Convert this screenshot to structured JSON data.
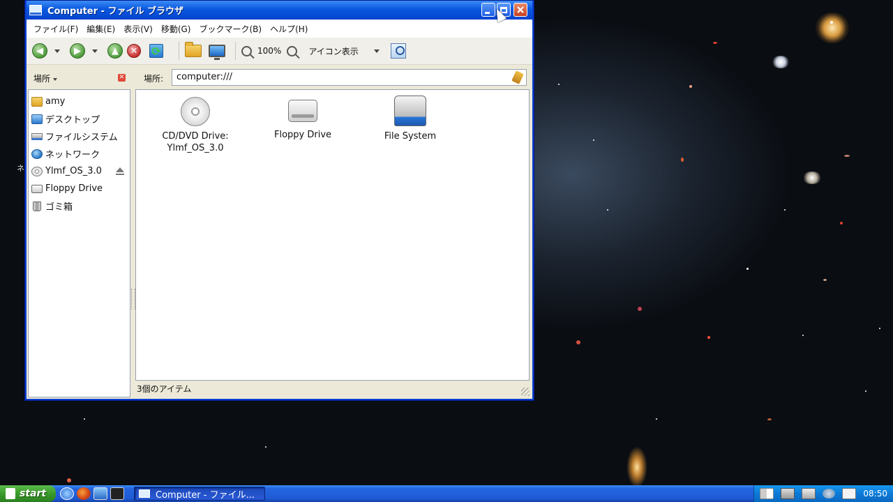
{
  "window": {
    "title": "Computer - ファイル ブラウザ"
  },
  "menubar": {
    "items": [
      "ファイル(F)",
      "編集(E)",
      "表示(V)",
      "移動(G)",
      "ブックマーク(B)",
      "ヘルプ(H)"
    ]
  },
  "toolbar": {
    "zoom": "100%",
    "view_mode": "アイコン表示"
  },
  "sidebar": {
    "header": "場所",
    "items": [
      {
        "label": "amy",
        "icon": "home-folder-icon"
      },
      {
        "label": "デスクトップ",
        "icon": "desktop-icon"
      },
      {
        "label": "ファイルシステム",
        "icon": "filesystem-icon"
      },
      {
        "label": "ネットワーク",
        "icon": "network-icon"
      },
      {
        "label": "Ylmf_OS_3.0",
        "icon": "cdrom-icon"
      },
      {
        "label": "Floppy Drive",
        "icon": "floppy-icon"
      },
      {
        "label": "ゴミ箱",
        "icon": "trash-icon"
      }
    ]
  },
  "location": {
    "label": "場所:",
    "value": "computer:///"
  },
  "files": [
    {
      "label": "CD/DVD Drive:",
      "label2": "Ylmf_OS_3.0",
      "icon": "cdrom-icon"
    },
    {
      "label": "Floppy Drive",
      "icon": "floppy-icon"
    },
    {
      "label": "File System",
      "icon": "harddisk-icon"
    }
  ],
  "status": {
    "text": "3個のアイテム"
  },
  "desktop": {
    "partial_text": "ネ"
  },
  "taskbar": {
    "start": "start",
    "task_title": "Computer - ファイル...",
    "clock": "08:50"
  }
}
